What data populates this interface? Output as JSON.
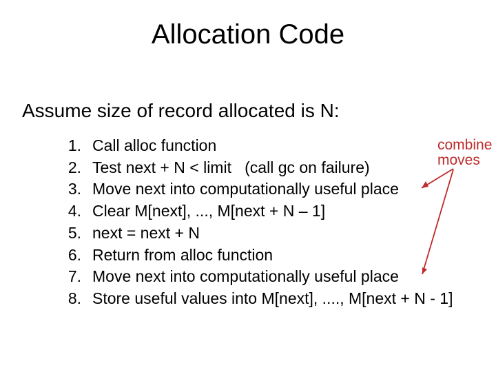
{
  "title": "Allocation Code",
  "intro": "Assume size of record allocated is N:",
  "steps": [
    {
      "num": "1.",
      "text": "Call alloc function"
    },
    {
      "num": "2.",
      "text": "Test next + N < limit   (call gc on failure)"
    },
    {
      "num": "3.",
      "text": "Move next into computationally useful place"
    },
    {
      "num": "4.",
      "text": "Clear M[next], ..., M[next + N – 1]"
    },
    {
      "num": "5.",
      "text": "next = next + N"
    },
    {
      "num": "6.",
      "text": "Return from alloc function"
    },
    {
      "num": "7.",
      "text": "Move next into computationally useful place"
    },
    {
      "num": "8.",
      "text": "Store useful values into M[next], ...., M[next + N - 1]"
    }
  ],
  "annotation": {
    "line1": "combine",
    "line2": "moves"
  },
  "annotation_color": "#bf2a2a"
}
